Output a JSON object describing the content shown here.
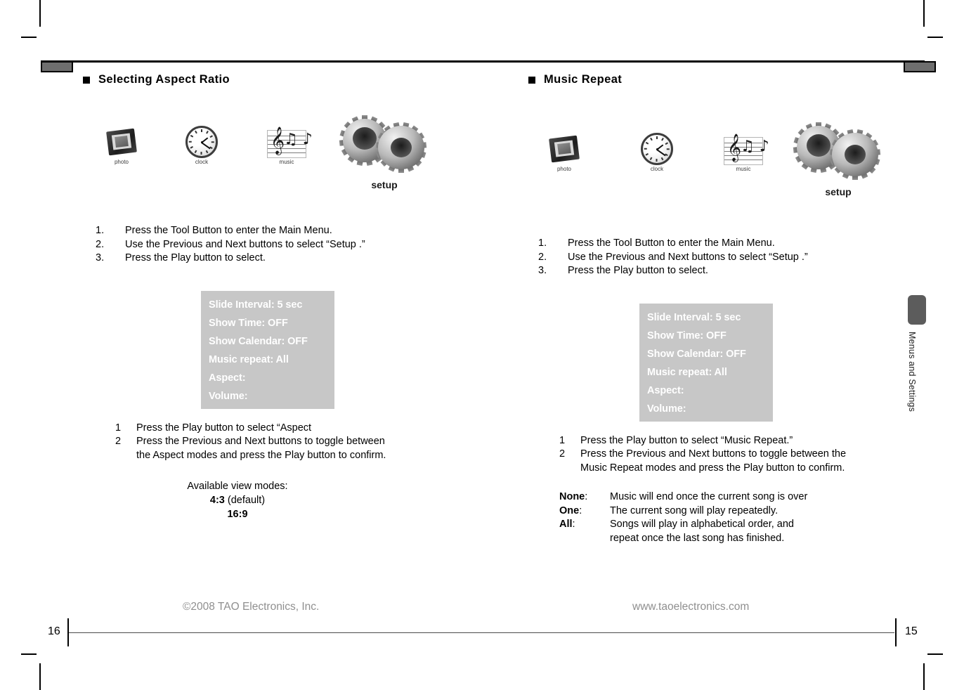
{
  "page": {
    "left_page_number": "16",
    "right_page_number": "15",
    "side_tab_label": "Menus and Settings"
  },
  "footer": {
    "copyright": "©2008 TAO Electronics, Inc.",
    "website": "www.taoelectronics.com"
  },
  "device_menu": {
    "lines": [
      "Slide Interval: 5 sec",
      "Show Time: OFF",
      "Show Calendar: OFF",
      "Music repeat: All",
      "Aspect:",
      "Volume:"
    ],
    "background_color": "#c7c7c7",
    "text_color": "#ffffff"
  },
  "icon_strip": {
    "photo_label": "photo",
    "clock_label": "clock",
    "music_label": "music",
    "setup_label": "setup"
  },
  "left_column": {
    "title": "Selecting Aspect Ratio",
    "steps": [
      {
        "num": "1.",
        "text": "Press the Tool Button to enter the Main Menu."
      },
      {
        "num": "2.",
        "text": "Use the Previous and Next buttons to select “Setup .”"
      },
      {
        "num": "3.",
        "text": "Press the Play button to select."
      }
    ],
    "substeps": [
      {
        "num": "1",
        "text": "Press the Play button to select “Aspect"
      },
      {
        "num": "2",
        "text": "Press the Previous and Next buttons to toggle between the Aspect modes and press the Play button to confirm."
      }
    ],
    "modes": {
      "heading": "Available view modes:",
      "option_1_bold": "4:3",
      "option_1_rest": " (default)",
      "option_2_bold": "16:9"
    }
  },
  "right_column": {
    "title": "Music Repeat",
    "steps": [
      {
        "num": "1.",
        "text": "Press the Tool Button to enter the Main Menu."
      },
      {
        "num": "2.",
        "text": "Use the Previous and Next buttons to select “Setup .”"
      },
      {
        "num": "3.",
        "text": "Press the Play button to select."
      }
    ],
    "substeps": [
      {
        "num": "1",
        "text": "Press the Play button to select “Music Repeat.”"
      },
      {
        "num": "2",
        "text": "Press the Previous and Next buttons to toggle between the Music Repeat modes and press the Play button to confirm."
      }
    ],
    "glossary": [
      {
        "term": "None",
        "colon": ":",
        "definition": "Music will end once the current song is over",
        "continued": ""
      },
      {
        "term": "One",
        "colon": ":",
        "definition": "The current song will play repeatedly.",
        "continued": ""
      },
      {
        "term": "All",
        "colon": ":",
        "definition": "Songs will play in alphabetical order, and",
        "continued": "repeat once the last song has finished."
      }
    ]
  }
}
